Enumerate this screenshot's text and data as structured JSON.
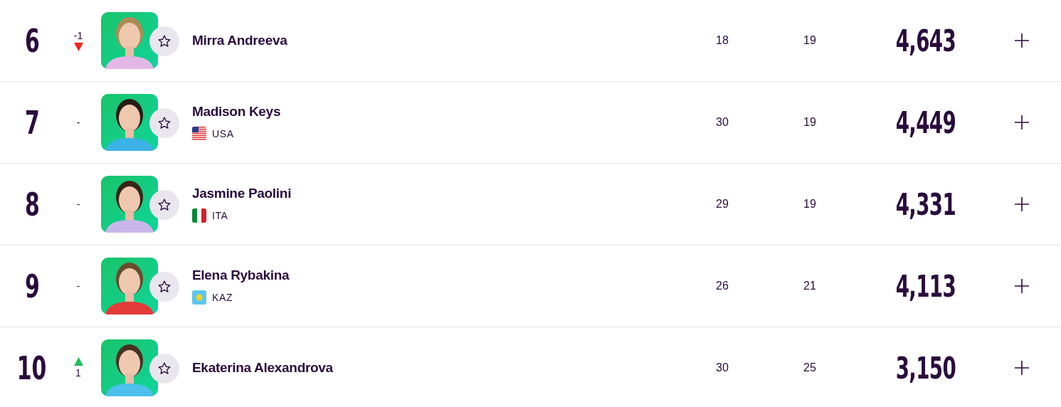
{
  "rows": [
    {
      "rank": "6",
      "movement": {
        "kind": "down",
        "text": "-1"
      },
      "name": "Mirra Andreeva",
      "age": "18",
      "tournaments": "19",
      "points": "4,643",
      "favorite": false
    },
    {
      "rank": "7",
      "movement": {
        "kind": "none",
        "text": "-"
      },
      "name": "Madison Keys",
      "country": {
        "code": "USA",
        "kind": "us"
      },
      "age": "30",
      "tournaments": "19",
      "points": "4,449",
      "favorite": false
    },
    {
      "rank": "8",
      "movement": {
        "kind": "none",
        "text": "-"
      },
      "name": "Jasmine Paolini",
      "country": {
        "code": "ITA",
        "kind": "it"
      },
      "age": "29",
      "tournaments": "19",
      "points": "4,331",
      "favorite": false
    },
    {
      "rank": "9",
      "movement": {
        "kind": "none",
        "text": "-"
      },
      "name": "Elena Rybakina",
      "country": {
        "code": "KAZ",
        "kind": "kz"
      },
      "age": "26",
      "tournaments": "21",
      "points": "4,113",
      "favorite": false
    },
    {
      "rank": "10",
      "movement": {
        "kind": "up",
        "text": "1"
      },
      "name": "Ekaterina Alexandrova",
      "age": "30",
      "tournaments": "25",
      "points": "3,150",
      "favorite": false
    }
  ]
}
